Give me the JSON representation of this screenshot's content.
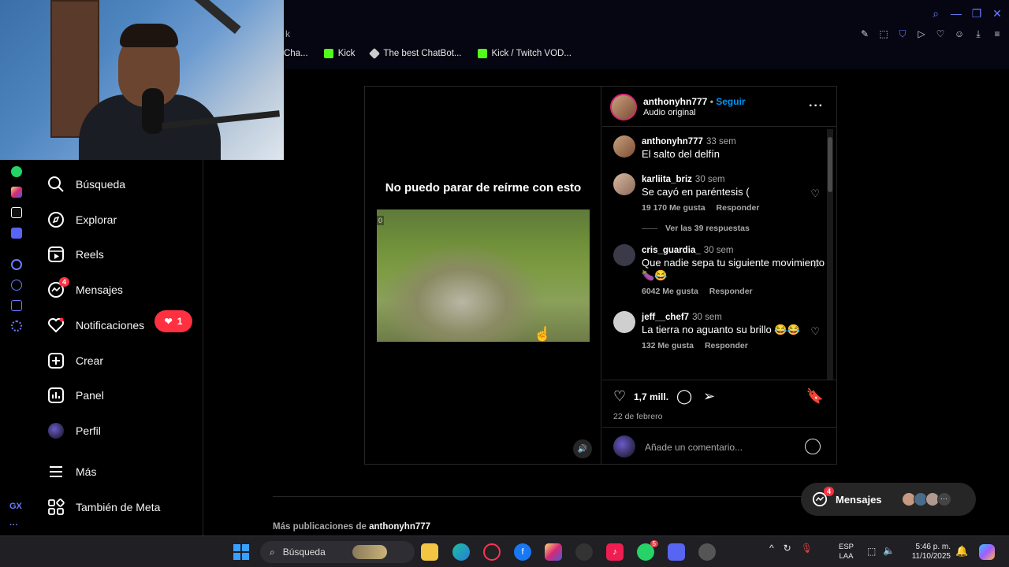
{
  "browser": {
    "address_fragment": "k",
    "bookmarks": [
      {
        "label": "Cha...",
        "color": "#ff8a00"
      },
      {
        "label": "Kick",
        "color": "#53fc18"
      },
      {
        "label": "The best ChatBot...",
        "color": "#cccccc"
      },
      {
        "label": "Kick / Twitch VOD...",
        "color": "#53fc18"
      }
    ]
  },
  "nav": {
    "items": [
      {
        "label": "Búsqueda",
        "icon": "search-icon"
      },
      {
        "label": "Explorar",
        "icon": "compass-icon"
      },
      {
        "label": "Reels",
        "icon": "reels-icon"
      },
      {
        "label": "Mensajes",
        "icon": "messenger-icon",
        "badge": "4"
      },
      {
        "label": "Notificaciones",
        "icon": "heart-icon"
      },
      {
        "label": "Crear",
        "icon": "plus-square-icon"
      },
      {
        "label": "Panel",
        "icon": "chart-icon"
      },
      {
        "label": "Perfil",
        "icon": "avatar-icon"
      },
      {
        "label": "Más",
        "icon": "menu-icon"
      },
      {
        "label": "También de Meta",
        "icon": "meta-apps-icon"
      }
    ],
    "notification_count": "1"
  },
  "post": {
    "caption_overlay": "No puedo parar de reírme con esto",
    "video_tag": "0",
    "username": "anthonyhn777",
    "follow": "Seguir",
    "separator": " • ",
    "audio": "Audio original",
    "likes": "1,7 mill.",
    "date": "22 de febrero",
    "comment_placeholder": "Añade un comentario..."
  },
  "comments": [
    {
      "user": "anthonyhn777",
      "time": "33 sem",
      "text": "El salto del delfín",
      "likes": "",
      "reply": "",
      "view_replies": ""
    },
    {
      "user": "karliita_briz",
      "time": "30 sem",
      "text": "Se cayó en paréntesis (",
      "likes": "19 170 Me gusta",
      "reply": "Responder",
      "view_replies": "Ver las 39 respuestas"
    },
    {
      "user": "cris_guardia_",
      "time": "30 sem",
      "text": "Que nadie sepa tu siguiente movimiento 🍆😂",
      "likes": "6042 Me gusta",
      "reply": "Responder",
      "view_replies": ""
    },
    {
      "user": "jeff__chef7",
      "time": "30 sem",
      "text": "La tierra no aguanto su brillo 😂😂",
      "likes": "132 Me gusta",
      "reply": "Responder",
      "view_replies": ""
    }
  ],
  "footer": {
    "more_posts_prefix": "Más publicaciones de ",
    "more_posts_user": "anthonyhn777"
  },
  "messages_pill": {
    "label": "Mensajes",
    "badge": "4"
  },
  "taskbar": {
    "search_placeholder": "Búsqueda",
    "lang_line1": "ESP",
    "lang_line2": "LAA",
    "time": "5:46 p. m.",
    "date": "11/10/2025",
    "badges": {
      "whatsapp": "5"
    }
  },
  "colors": {
    "accent_blue": "#0095f6",
    "notification_red": "#ff3040",
    "opera_accent": "#6a7cff"
  }
}
